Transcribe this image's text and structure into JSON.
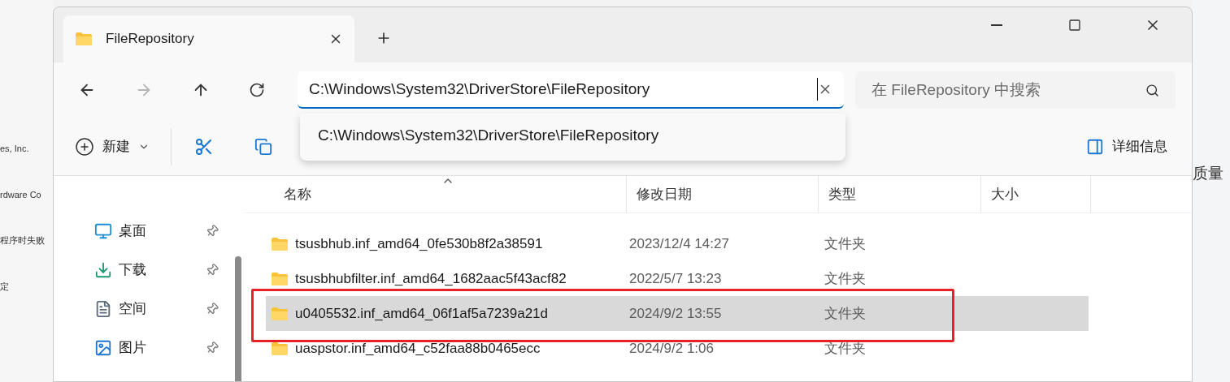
{
  "background_left": {
    "texts": [
      "es, Inc.",
      "rdware Co",
      "程序时失败",
      "定"
    ]
  },
  "tab": {
    "title": "FileRepository",
    "selected": true
  },
  "address": {
    "value": "C:\\Windows\\System32\\DriverStore\\FileRepository"
  },
  "search": {
    "placeholder": "在 FileRepository 中搜索"
  },
  "suggestions": [
    "C:\\Windows\\System32\\DriverStore\\FileRepository"
  ],
  "toolbar": {
    "new_label": "新建",
    "details_label": "详细信息"
  },
  "sidebar": {
    "items": [
      {
        "label": "桌面",
        "kind": "desktop"
      },
      {
        "label": "下载",
        "kind": "download"
      },
      {
        "label": "空间",
        "kind": "document"
      },
      {
        "label": "图片",
        "kind": "picture"
      }
    ]
  },
  "columns": [
    "名称",
    "修改日期",
    "类型",
    "大小"
  ],
  "rows": [
    {
      "name": "tsusbhub.inf_amd64_0fe530b8f2a38591",
      "modified": "2023/12/4 14:27",
      "type": "文件夹",
      "selected": false
    },
    {
      "name": "tsusbhubfilter.inf_amd64_1682aac5f43acf82",
      "modified": "2022/5/7 13:23",
      "type": "文件夹",
      "selected": false
    },
    {
      "name": "u0405532.inf_amd64_06f1af5a7239a21d",
      "modified": "2024/9/2 13:55",
      "type": "文件夹",
      "selected": true
    },
    {
      "name": "uaspstor.inf_amd64_c52faa88b0465ecc",
      "modified": "2024/9/2 1:06",
      "type": "文件夹",
      "selected": false
    }
  ],
  "highlight": {
    "shown": true
  },
  "background_right": {
    "text": "质量"
  }
}
